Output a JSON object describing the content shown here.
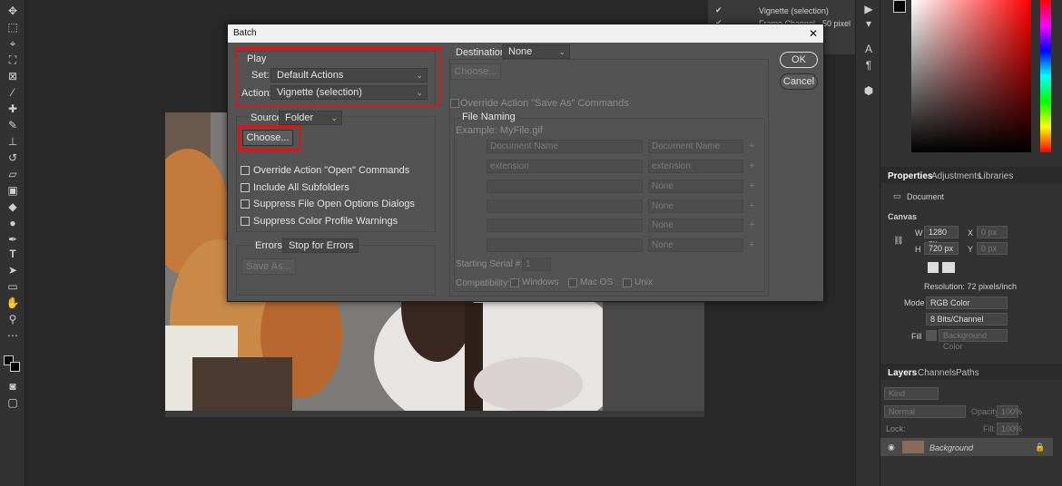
{
  "dialog": {
    "title": "Batch",
    "close_label": "✕",
    "play": {
      "section_label": "Play",
      "set_label": "Set:",
      "set_value": "Default Actions",
      "action_label": "Action:",
      "action_value": "Vignette (selection)"
    },
    "source": {
      "label": "Source:",
      "value": "Folder",
      "choose_label": "Choose...",
      "options": [
        "Override Action \"Open\" Commands",
        "Include All Subfolders",
        "Suppress File Open Options Dialogs",
        "Suppress Color Profile Warnings"
      ]
    },
    "errors": {
      "label": "Errors:",
      "value": "Stop for Errors",
      "save_as_label": "Save As..."
    },
    "destination": {
      "label": "Destination:",
      "value": "None",
      "choose_label": "Choose...",
      "override_label": "Override Action \"Save As\" Commands"
    },
    "file_naming": {
      "label": "File Naming",
      "example": "Example: MyFile.gif",
      "rows": [
        {
          "left": "Document Name",
          "right": "Document Name"
        },
        {
          "left": "extension",
          "right": "extension"
        },
        {
          "left": "",
          "right": "None"
        },
        {
          "left": "",
          "right": "None"
        },
        {
          "left": "",
          "right": "None"
        },
        {
          "left": "",
          "right": "None"
        }
      ],
      "serial_label": "Starting Serial #:",
      "serial_value": "1",
      "compat_label": "Compatibility:",
      "compat_options": [
        "Windows",
        "Mac OS",
        "Unix"
      ]
    },
    "ok_label": "OK",
    "cancel_label": "Cancel"
  },
  "actions_panel": {
    "items": [
      "Vignette (selection)",
      "Frame Channel - 50 pixel"
    ]
  },
  "properties": {
    "tabs": [
      "Properties",
      "Adjustments",
      "Libraries"
    ],
    "doc_label": "Document",
    "canvas_label": "Canvas",
    "w_label": "W",
    "w_value": "1280 px",
    "h_label": "H",
    "h_value": "720 px",
    "x_label": "X",
    "x_value": "0 px",
    "y_label": "Y",
    "y_value": "0 px",
    "resolution": "Resolution: 72 pixels/inch",
    "mode_label": "Mode",
    "mode_value": "RGB Color",
    "depth_value": "8 Bits/Channel",
    "fill_label": "Fill",
    "fill_value": "Background Color"
  },
  "layers": {
    "tabs": [
      "Layers",
      "Channels",
      "Paths"
    ],
    "kind": "Kind",
    "blend": "Normal",
    "opacity_label": "Opacity:",
    "opacity_value": "100%",
    "lock_label": "Lock:",
    "fill_label": "Fill:",
    "fill_value": "100%",
    "layer_name": "Background"
  },
  "colors": {
    "accent_red": "#c81e1e",
    "dialog_bg": "#535353",
    "panel_bg": "#323232"
  }
}
